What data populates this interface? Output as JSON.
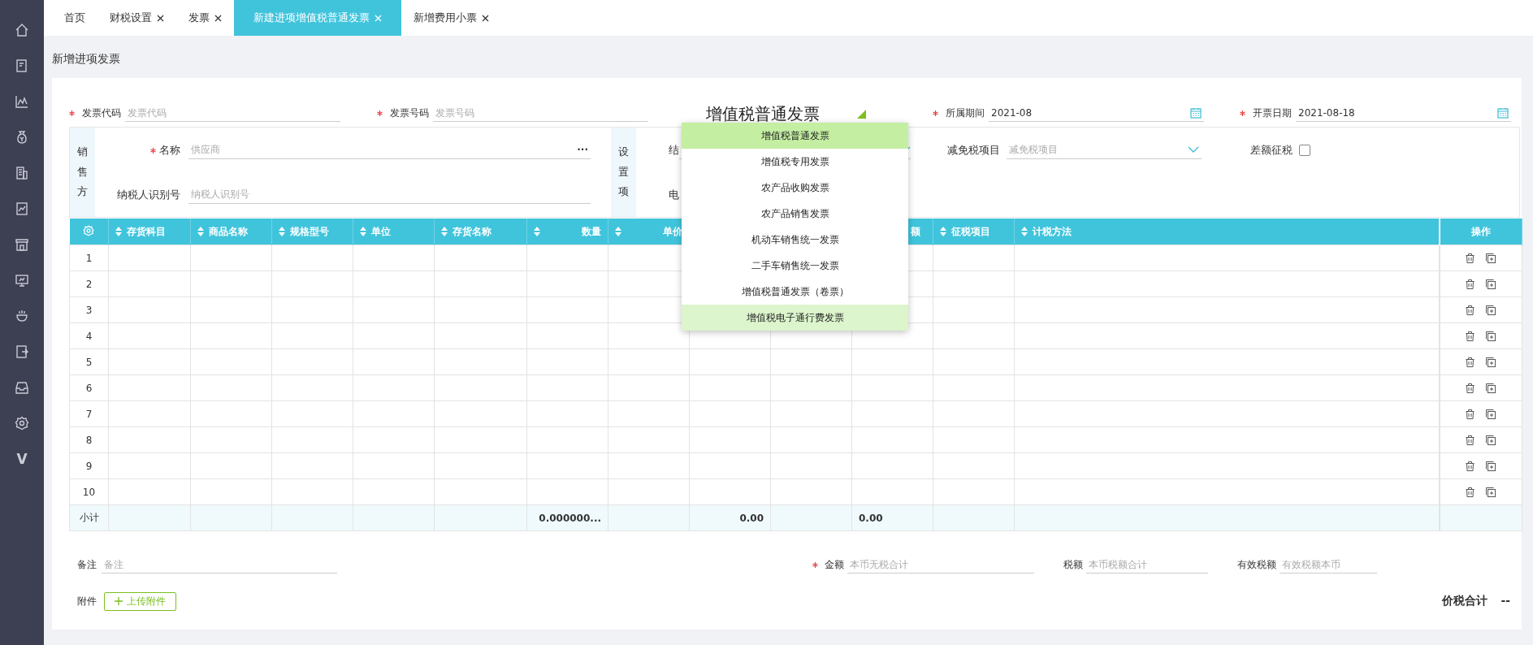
{
  "sidebar_logo": "V",
  "tabs": [
    {
      "label": "首页",
      "closable": false,
      "selected": false
    },
    {
      "label": "财税设置",
      "closable": true,
      "selected": false
    },
    {
      "label": "发票",
      "closable": true,
      "selected": false
    },
    {
      "label": "新建进项增值税普通发票",
      "closable": true,
      "selected": true
    },
    {
      "label": "新增费用小票",
      "closable": true,
      "selected": false
    }
  ],
  "page_title": "新增进项发票",
  "header_fields": [
    {
      "label": "发票代码",
      "required": true,
      "placeholder": "发票代码"
    },
    {
      "label": "发票号码",
      "required": true,
      "placeholder": "发票号码"
    }
  ],
  "invoice_type": {
    "title": "增值税普通发票",
    "options": [
      {
        "label": "增值税普通发票",
        "selected": true,
        "hovered": false
      },
      {
        "label": "增值税专用发票",
        "selected": false,
        "hovered": false
      },
      {
        "label": "农产品收购发票",
        "selected": false,
        "hovered": false
      },
      {
        "label": "农产品销售发票",
        "selected": false,
        "hovered": false
      },
      {
        "label": "机动车销售统一发票",
        "selected": false,
        "hovered": false
      },
      {
        "label": "二手车销售统一发票",
        "selected": false,
        "hovered": false
      },
      {
        "label": "增值税普通发票（卷票）",
        "selected": false,
        "hovered": false
      },
      {
        "label": "增值税电子通行费发票",
        "selected": false,
        "hovered": true
      }
    ]
  },
  "date_fields": [
    {
      "label": "所属期间",
      "required": true,
      "value": "2021-08"
    },
    {
      "label": "开票日期",
      "required": true,
      "value": "2021-08-18"
    }
  ],
  "seller": {
    "heading": "销售方",
    "fields": [
      {
        "label": "名称",
        "required": true,
        "placeholder": "供应商",
        "more": "···"
      },
      {
        "label": "纳税人识别号",
        "required": false,
        "placeholder": "纳税人识别号"
      }
    ]
  },
  "settings": {
    "heading": "设置项",
    "labels": [
      "结",
      "电"
    ],
    "exemption": {
      "label": "减免税项目",
      "placeholder": "减免税项目"
    },
    "difference_tax": {
      "label": "差额征税",
      "checked": false
    }
  },
  "table": {
    "columns": [
      {
        "label": "存货科目",
        "sortable": true,
        "numeric": false
      },
      {
        "label": "商品名称",
        "sortable": true,
        "numeric": false
      },
      {
        "label": "规格型号",
        "sortable": true,
        "numeric": false
      },
      {
        "label": "单位",
        "sortable": true,
        "numeric": false
      },
      {
        "label": "存货名称",
        "sortable": true,
        "numeric": false
      },
      {
        "label": "数量",
        "sortable": true,
        "numeric": true,
        "subtotal": "0.000000..."
      },
      {
        "label": "单价",
        "sortable": true,
        "numeric": true
      },
      {
        "numeric": true,
        "subtotal": "0.00"
      },
      {},
      {
        "label": "额",
        "sortable": false,
        "numeric": false,
        "subtotal": "0.00"
      },
      {
        "label": "征税项目",
        "sortable": true,
        "numeric": false
      },
      {
        "label": "计税方法",
        "sortable": true,
        "numeric": false
      },
      {
        "label": "操作",
        "sortable": false
      }
    ],
    "rows": [
      {
        "number": "1"
      },
      {
        "number": "2"
      },
      {
        "number": "3"
      },
      {
        "number": "4"
      },
      {
        "number": "5"
      },
      {
        "number": "6"
      },
      {
        "number": "7"
      },
      {
        "number": "8"
      },
      {
        "number": "9"
      },
      {
        "number": "10"
      }
    ],
    "subtotal_label": "小计"
  },
  "remarks": {
    "label": "备注",
    "placeholder": "备注"
  },
  "attachment": {
    "label": "附件",
    "button": "上传附件"
  },
  "totals": [
    {
      "label": "金额",
      "required": true,
      "placeholder": "本币无税合计"
    },
    {
      "label": "税额",
      "required": false,
      "placeholder": "本币税额合计"
    },
    {
      "label": "有效税额",
      "required": false,
      "placeholder": "有效税额本币"
    }
  ],
  "grand_total": {
    "label": "价税合计",
    "value": "--"
  }
}
